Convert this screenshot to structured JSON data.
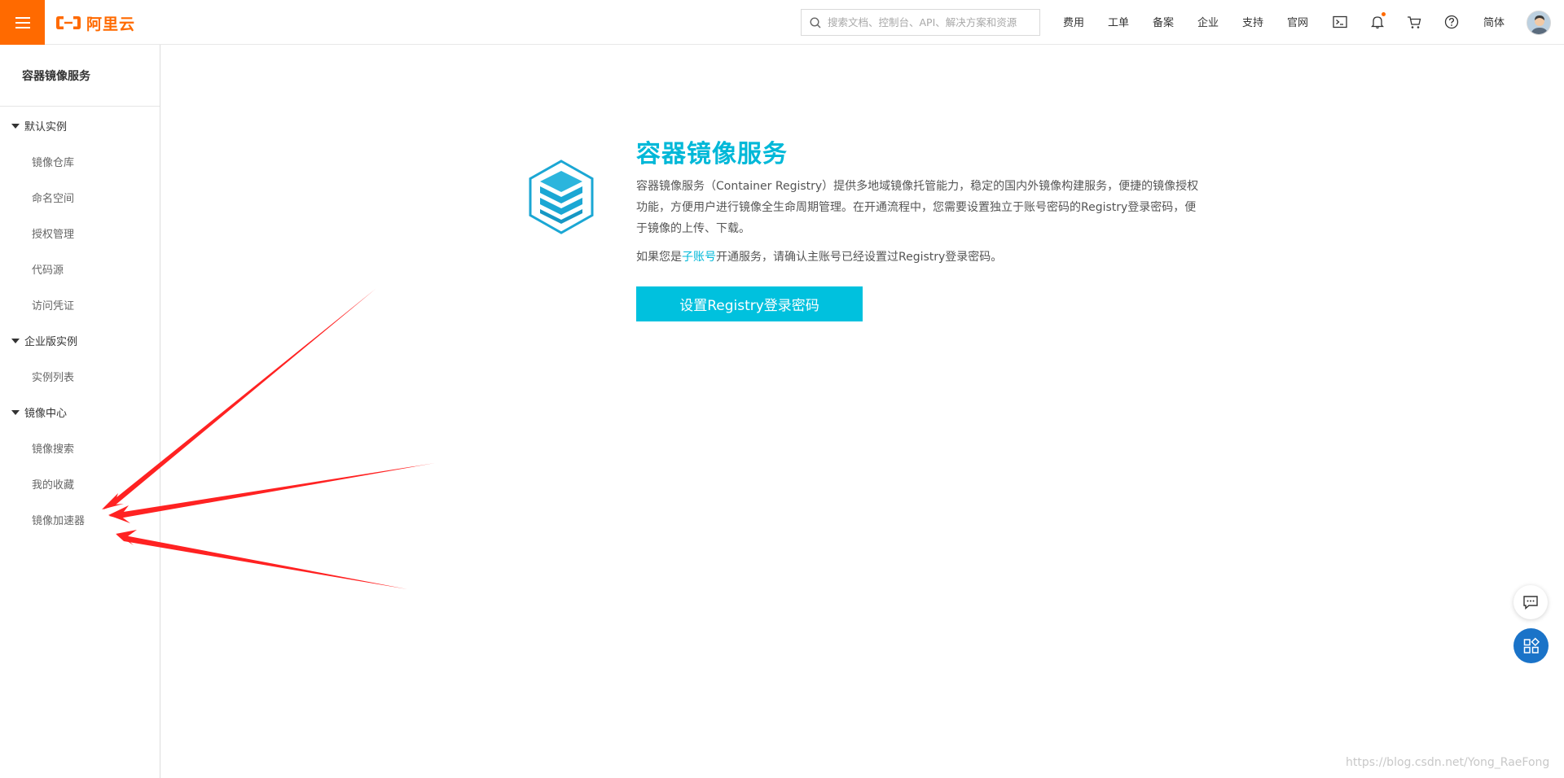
{
  "brand": {
    "name": "阿里云",
    "color": "#ff6a00",
    "accent": "#00c1de"
  },
  "topbar": {
    "search_placeholder": "搜索文档、控制台、API、解决方案和资源",
    "links": [
      "费用",
      "工单",
      "备案",
      "企业",
      "支持",
      "官网"
    ],
    "language": "简体",
    "icons": [
      "terminal-icon",
      "bell-icon",
      "cart-icon",
      "help-icon"
    ]
  },
  "sidebar": {
    "title": "容器镜像服务",
    "groups": [
      {
        "label": "默认实例",
        "items": [
          "镜像仓库",
          "命名空间",
          "授权管理",
          "代码源",
          "访问凭证"
        ]
      },
      {
        "label": "企业版实例",
        "items": [
          "实例列表"
        ]
      },
      {
        "label": "镜像中心",
        "items": [
          "镜像搜索",
          "我的收藏",
          "镜像加速器"
        ]
      }
    ]
  },
  "main": {
    "title": "容器镜像服务",
    "description": "容器镜像服务（Container Registry）提供多地域镜像托管能力，稳定的国内外镜像构建服务，便捷的镜像授权功能，方便用户进行镜像全生命周期管理。在开通流程中，您需要设置独立于账号密码的Registry登录密码，便于镜像的上传、下载。",
    "note_prefix": "如果您是",
    "note_link": "子账号",
    "note_suffix": "开通服务，请确认主账号已经设置过Registry登录密码。",
    "button_label": "设置Registry登录密码"
  },
  "watermark": "https://blog.csdn.net/Yong_RaeFong"
}
